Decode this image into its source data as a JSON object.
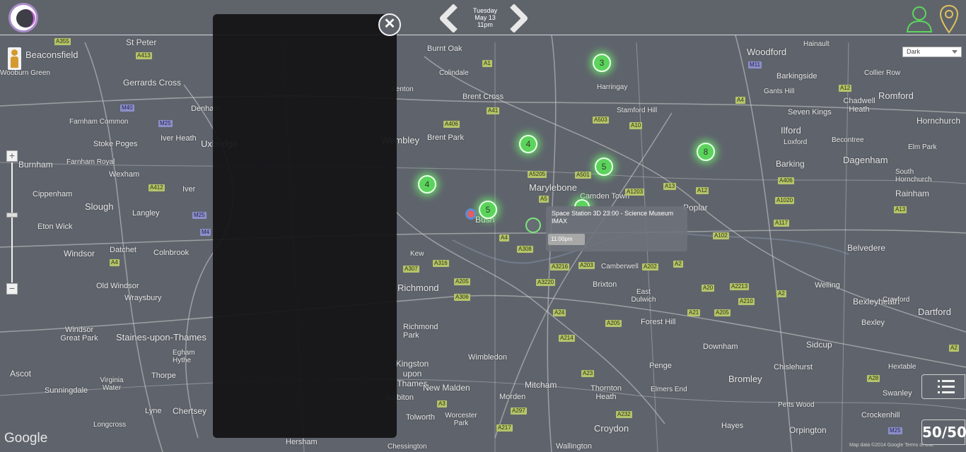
{
  "header": {
    "day": "Tuesday",
    "date": "May 13",
    "time": "11pm"
  },
  "map_controls": {
    "zoom_in": "+",
    "zoom_out": "−",
    "style_select": "Dark"
  },
  "tooltip": {
    "title": "Space Station 3D 23:00 - Science Museum IMAX",
    "time": "11:00pm"
  },
  "clusters": [
    {
      "count": "3"
    },
    {
      "count": "4"
    },
    {
      "count": "5"
    },
    {
      "count": "8"
    },
    {
      "count": "4"
    },
    {
      "count": "5"
    }
  ],
  "brand": "50/50",
  "map_footer": {
    "google": "Google",
    "attribution": "Map data ©2014 Google Terms of Use"
  },
  "place_labels": [
    "Beaconsfield",
    "St Peter",
    "Wooburn Green",
    "Gerrards Cross",
    "Farnham Common",
    "Stoke Poges",
    "Burnham",
    "Farnham Royal",
    "Wexham",
    "Slough",
    "Cippenham",
    "Langley",
    "Eton Wick",
    "Windsor",
    "Datchet",
    "Colnbrook",
    "Old Windsor",
    "Wraysbury",
    "Windsor Great Park",
    "Staines-upon-Thames",
    "Egham Hythe",
    "Thorpe",
    "Virginia Water",
    "Ascot",
    "Sunningdale",
    "Lyne",
    "Chertsey",
    "Longcross",
    "Denham",
    "Iver Heath",
    "Uxbridge",
    "Iver",
    "Burnt Oak",
    "Colindale",
    "Brent Cross",
    "Wembley",
    "Brent Park",
    "Kenton",
    "Marylebone",
    "Camden Town",
    "Harringay",
    "Stamford Hill",
    "Woodford",
    "Barkingside",
    "Romford",
    "Chadwell Heath",
    "Seven Kings",
    "Ilford",
    "Loxford",
    "Barking",
    "Dagenham",
    "Rainham",
    "South Hornchurch",
    "Hornchurch",
    "Elm Park",
    "Becontree",
    "Hainault",
    "Collier Row",
    "Gants Hill",
    "Poplar",
    "Belvedere",
    "Welling",
    "Bexleyheath",
    "Crayford",
    "Dartford",
    "Bexley",
    "Sidcup",
    "Chislehurst",
    "Hextable",
    "Swanley",
    "Crockenhill",
    "Petts Wood",
    "Orpington",
    "Hayes",
    "Bromley",
    "Downham",
    "Penge",
    "Elmers End",
    "Forest Hill",
    "East Dulwich",
    "Brixton",
    "Camberwell",
    "Kew",
    "Richmond",
    "Richmond Park",
    "Kingston upon Thames",
    "New Malden",
    "Wimbledon",
    "Mitcham",
    "Morden",
    "Thornton Heath",
    "Croydon",
    "Wallington",
    "Surbiton",
    "Tolworth",
    "Worcester Park",
    "Chessington",
    "Hersham",
    "Bush"
  ],
  "road_shields": [
    "A355",
    "A413",
    "M40",
    "M25",
    "A412",
    "M4",
    "M25",
    "A4",
    "A1",
    "A41",
    "A406",
    "A503",
    "A10",
    "A5205",
    "A501",
    "A1203",
    "A13",
    "A12",
    "A406",
    "A1020",
    "A117",
    "A102",
    "A2",
    "A20",
    "A2213",
    "A210",
    "A205",
    "A21",
    "A205",
    "A23",
    "A24",
    "A214",
    "A232",
    "A217",
    "A297",
    "A3",
    "A307",
    "A316",
    "A205",
    "A306",
    "A4",
    "A308",
    "A3216",
    "A3220",
    "A203",
    "A202",
    "A2",
    "A13",
    "M11",
    "A12",
    "A4",
    "A28",
    "M25",
    "A2",
    "A5"
  ]
}
